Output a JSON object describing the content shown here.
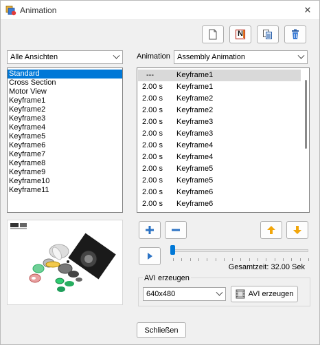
{
  "window": {
    "title": "Animation",
    "close_glyph": "✕"
  },
  "toolbar": {
    "buttons": [
      {
        "name": "new-document-button",
        "icon": "document-icon"
      },
      {
        "name": "new-from-template-button",
        "icon": "ni-icon",
        "icon_text": "N"
      },
      {
        "name": "copy-button",
        "icon": "copy-icon"
      },
      {
        "name": "delete-button",
        "icon": "trash-icon"
      }
    ]
  },
  "views": {
    "filter_value": "Alle Ansichten",
    "items": [
      "Standard",
      "Cross Section",
      "Motor View",
      "Keyframe1",
      "Keyframe2",
      "Keyframe3",
      "Keyframe4",
      "Keyframe5",
      "Keyframe6",
      "Keyframe7",
      "Keyframe8",
      "Keyframe9",
      "Keyframe10",
      "Keyframe11"
    ],
    "selected_index": 0
  },
  "animation": {
    "label": "Animation",
    "value": "Assembly Animation",
    "keyframes": [
      {
        "time": "---",
        "name": "Keyframe1"
      },
      {
        "time": "2.00 s",
        "name": "Keyframe1"
      },
      {
        "time": "2.00 s",
        "name": "Keyframe2"
      },
      {
        "time": "2.00 s",
        "name": "Keyframe2"
      },
      {
        "time": "2.00 s",
        "name": "Keyframe3"
      },
      {
        "time": "2.00 s",
        "name": "Keyframe3"
      },
      {
        "time": "2.00 s",
        "name": "Keyframe4"
      },
      {
        "time": "2.00 s",
        "name": "Keyframe4"
      },
      {
        "time": "2.00 s",
        "name": "Keyframe5"
      },
      {
        "time": "2.00 s",
        "name": "Keyframe5"
      },
      {
        "time": "2.00 s",
        "name": "Keyframe6"
      },
      {
        "time": "2.00 s",
        "name": "Keyframe6"
      }
    ],
    "selected_index": 0
  },
  "playback": {
    "total_time": "Gesamtzeit: 32.00 Sek",
    "slider_fraction": 0.0
  },
  "avi": {
    "group_title": "AVI erzeugen",
    "resolution": "640x480",
    "create_label": "AVI erzeugen"
  },
  "footer": {
    "close_label": "Schließen"
  },
  "colors": {
    "accent": "#0078d7",
    "orange": "#f2a60a"
  }
}
